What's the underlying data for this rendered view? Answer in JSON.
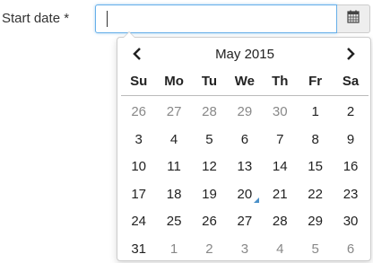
{
  "field": {
    "label": "Start date *",
    "value": "",
    "placeholder": ""
  },
  "calendar_button": {
    "icon": "calendar-icon"
  },
  "datepicker": {
    "title": "May 2015",
    "prev_icon": "chevron-left-icon",
    "next_icon": "chevron-right-icon",
    "weekdays": [
      "Su",
      "Mo",
      "Tu",
      "We",
      "Th",
      "Fr",
      "Sa"
    ],
    "weeks": [
      [
        {
          "d": "26",
          "other": true
        },
        {
          "d": "27",
          "other": true
        },
        {
          "d": "28",
          "other": true
        },
        {
          "d": "29",
          "other": true
        },
        {
          "d": "30",
          "other": true
        },
        {
          "d": "1"
        },
        {
          "d": "2"
        }
      ],
      [
        {
          "d": "3"
        },
        {
          "d": "4"
        },
        {
          "d": "5"
        },
        {
          "d": "6"
        },
        {
          "d": "7"
        },
        {
          "d": "8"
        },
        {
          "d": "9"
        }
      ],
      [
        {
          "d": "10"
        },
        {
          "d": "11"
        },
        {
          "d": "12"
        },
        {
          "d": "13"
        },
        {
          "d": "14"
        },
        {
          "d": "15"
        },
        {
          "d": "16"
        }
      ],
      [
        {
          "d": "17"
        },
        {
          "d": "18"
        },
        {
          "d": "19"
        },
        {
          "d": "20",
          "today": true
        },
        {
          "d": "21"
        },
        {
          "d": "22"
        },
        {
          "d": "23"
        }
      ],
      [
        {
          "d": "24"
        },
        {
          "d": "25"
        },
        {
          "d": "26"
        },
        {
          "d": "27"
        },
        {
          "d": "28"
        },
        {
          "d": "29"
        },
        {
          "d": "30"
        }
      ],
      [
        {
          "d": "31"
        },
        {
          "d": "1",
          "other": true
        },
        {
          "d": "2",
          "other": true
        },
        {
          "d": "3",
          "other": true
        },
        {
          "d": "4",
          "other": true
        },
        {
          "d": "5",
          "other": true
        },
        {
          "d": "6",
          "other": true
        }
      ]
    ],
    "colors": {
      "other_month": "#888888",
      "today_marker": "#4a90c8",
      "focus_border": "#66afe9"
    }
  }
}
